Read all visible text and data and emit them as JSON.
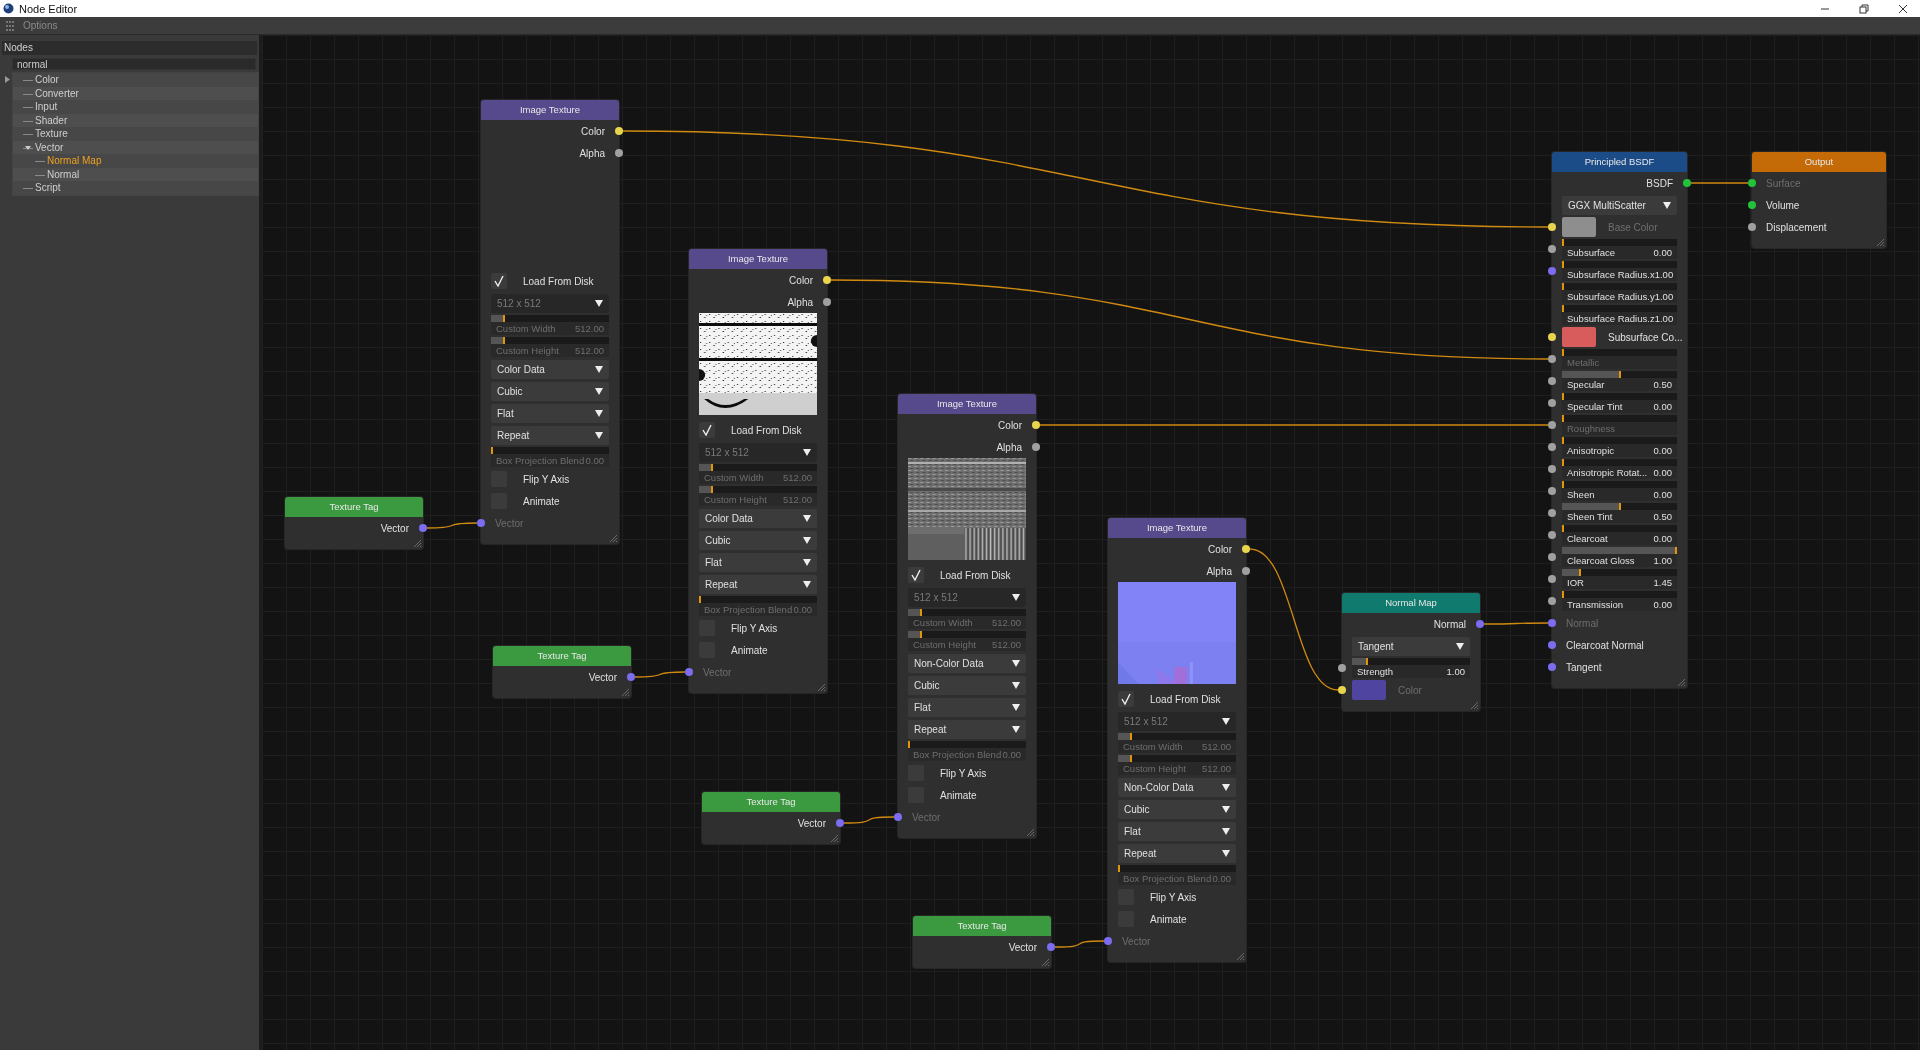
{
  "window": {
    "title": "Node Editor"
  },
  "menu": [
    "Options"
  ],
  "sidebar": {
    "title": "Nodes",
    "search": {
      "value": "normal"
    },
    "tree": [
      {
        "label": "Color",
        "selected": false
      },
      {
        "label": "Converter",
        "selected": false
      },
      {
        "label": "Input",
        "selected": false
      },
      {
        "label": "Shader",
        "selected": false
      },
      {
        "label": "Texture",
        "selected": false
      },
      {
        "label": "Vector",
        "selected": false,
        "expanded": true,
        "children": [
          {
            "label": "Normal Map",
            "selected": true
          },
          {
            "label": "Normal",
            "selected": false
          }
        ]
      },
      {
        "label": "Script",
        "selected": false
      }
    ]
  },
  "nodes": [
    {
      "title": "Image Texture",
      "color": "#574a8c",
      "rows": [
        {
          "kind": "output",
          "label": "Color",
          "socket": {
            "color": "#e8d44d"
          },
          "disabled": false
        },
        {
          "kind": "output",
          "label": "Alpha",
          "socket": {
            "color": "#a0a0a0"
          },
          "disabled": false
        },
        {
          "kind": "blank"
        },
        {
          "kind": "checkbox",
          "label": "Load From Disk",
          "checked": true
        },
        {
          "kind": "dropdown",
          "value": "512 x 512",
          "disabled": true
        },
        {
          "kind": "slider",
          "label": "Custom Width",
          "value": "512.00",
          "level": 0.1,
          "disabled": true
        },
        {
          "kind": "slider",
          "label": "Custom Height",
          "value": "512.00",
          "level": 0.1,
          "disabled": true
        },
        {
          "kind": "dropdown",
          "value": "Color Data",
          "disabled": false
        },
        {
          "kind": "dropdown",
          "value": "Cubic",
          "disabled": false
        },
        {
          "kind": "dropdown",
          "value": "Flat",
          "disabled": false
        },
        {
          "kind": "dropdown",
          "value": "Repeat",
          "disabled": false
        },
        {
          "kind": "slider",
          "label": "Box Projection Blend",
          "value": "0.00",
          "level": 0,
          "disabled": true
        },
        {
          "kind": "checkbox",
          "label": "Flip Y Axis",
          "checked": false
        },
        {
          "kind": "checkbox",
          "label": "Animate",
          "checked": false
        },
        {
          "kind": "input",
          "label": "Vector",
          "socket": {
            "color": "#7b6cf0"
          },
          "disabled": true
        }
      ]
    },
    {
      "title": "Image Texture",
      "color": "#574a8c",
      "rows": [
        {
          "kind": "output",
          "label": "Color",
          "socket": {
            "color": "#e8d44d"
          },
          "disabled": false
        },
        {
          "kind": "output",
          "label": "Alpha",
          "socket": {
            "color": "#a0a0a0"
          },
          "disabled": false
        },
        {
          "kind": "picture"
        },
        {
          "kind": "checkbox",
          "label": "Load From Disk",
          "checked": true
        },
        {
          "kind": "dropdown",
          "value": "512 x 512",
          "disabled": true
        },
        {
          "kind": "slider",
          "label": "Custom Width",
          "value": "512.00",
          "level": 0.1,
          "disabled": true
        },
        {
          "kind": "slider",
          "label": "Custom Height",
          "value": "512.00",
          "level": 0.1,
          "disabled": true
        },
        {
          "kind": "dropdown",
          "value": "Color Data",
          "disabled": false
        },
        {
          "kind": "dropdown",
          "value": "Cubic",
          "disabled": false
        },
        {
          "kind": "dropdown",
          "value": "Flat",
          "disabled": false
        },
        {
          "kind": "dropdown",
          "value": "Repeat",
          "disabled": false
        },
        {
          "kind": "slider",
          "label": "Box Projection Blend",
          "value": "0.00",
          "level": 0,
          "disabled": true
        },
        {
          "kind": "checkbox",
          "label": "Flip Y Axis",
          "checked": false
        },
        {
          "kind": "checkbox",
          "label": "Animate",
          "checked": false
        },
        {
          "kind": "input",
          "label": "Vector",
          "socket": {
            "color": "#7b6cf0"
          },
          "disabled": true
        }
      ]
    },
    {
      "title": "Image Texture",
      "color": "#574a8c",
      "rows": [
        {
          "kind": "output",
          "label": "Color",
          "socket": {
            "color": "#e8d44d"
          },
          "disabled": false
        },
        {
          "kind": "output",
          "label": "Alpha",
          "socket": {
            "color": "#a0a0a0"
          },
          "disabled": false
        },
        {
          "kind": "picture"
        },
        {
          "kind": "checkbox",
          "label": "Load From Disk",
          "checked": true
        },
        {
          "kind": "dropdown",
          "value": "512 x 512",
          "disabled": true
        },
        {
          "kind": "slider",
          "label": "Custom Width",
          "value": "512.00",
          "level": 0.1,
          "disabled": true
        },
        {
          "kind": "slider",
          "label": "Custom Height",
          "value": "512.00",
          "level": 0.1,
          "disabled": true
        },
        {
          "kind": "dropdown",
          "value": "Non-Color Data",
          "disabled": false
        },
        {
          "kind": "dropdown",
          "value": "Cubic",
          "disabled": false
        },
        {
          "kind": "dropdown",
          "value": "Flat",
          "disabled": false
        },
        {
          "kind": "dropdown",
          "value": "Repeat",
          "disabled": false
        },
        {
          "kind": "slider",
          "label": "Box Projection Blend",
          "value": "0.00",
          "level": 0,
          "disabled": true
        },
        {
          "kind": "checkbox",
          "label": "Flip Y Axis",
          "checked": false
        },
        {
          "kind": "checkbox",
          "label": "Animate",
          "checked": false
        },
        {
          "kind": "input",
          "label": "Vector",
          "socket": {
            "color": "#7b6cf0"
          },
          "disabled": true
        }
      ]
    },
    {
      "title": "Image Texture",
      "color": "#574a8c",
      "rows": [
        {
          "kind": "output",
          "label": "Color",
          "socket": {
            "color": "#e8d44d"
          },
          "disabled": false
        },
        {
          "kind": "output",
          "label": "Alpha",
          "socket": {
            "color": "#a0a0a0"
          },
          "disabled": false
        },
        {
          "kind": "picture"
        },
        {
          "kind": "checkbox",
          "label": "Load From Disk",
          "checked": true
        },
        {
          "kind": "dropdown",
          "value": "512 x 512",
          "disabled": true
        },
        {
          "kind": "slider",
          "label": "Custom Width",
          "value": "512.00",
          "level": 0.1,
          "disabled": true
        },
        {
          "kind": "slider",
          "label": "Custom Height",
          "value": "512.00",
          "level": 0.1,
          "disabled": true
        },
        {
          "kind": "dropdown",
          "value": "Non-Color Data",
          "disabled": false
        },
        {
          "kind": "dropdown",
          "value": "Cubic",
          "disabled": false
        },
        {
          "kind": "dropdown",
          "value": "Flat",
          "disabled": false
        },
        {
          "kind": "dropdown",
          "value": "Repeat",
          "disabled": false
        },
        {
          "kind": "slider",
          "label": "Box Projection Blend",
          "value": "0.00",
          "level": 0,
          "disabled": true
        },
        {
          "kind": "checkbox",
          "label": "Flip Y Axis",
          "checked": false
        },
        {
          "kind": "checkbox",
          "label": "Animate",
          "checked": false
        },
        {
          "kind": "input",
          "label": "Vector",
          "socket": {
            "color": "#7b6cf0"
          },
          "disabled": true
        }
      ]
    },
    {
      "title": "Texture Tag",
      "color": "#3b9a40",
      "rows": [
        {
          "kind": "output",
          "label": "Vector",
          "socket": {
            "color": "#7b6cf0"
          },
          "disabled": false
        }
      ]
    },
    {
      "title": "Texture Tag",
      "color": "#3b9a40",
      "rows": [
        {
          "kind": "output",
          "label": "Vector",
          "socket": {
            "color": "#7b6cf0"
          },
          "disabled": false
        }
      ]
    },
    {
      "title": "Texture Tag",
      "color": "#3b9a40",
      "rows": [
        {
          "kind": "output",
          "label": "Vector",
          "socket": {
            "color": "#7b6cf0"
          },
          "disabled": false
        }
      ]
    },
    {
      "title": "Texture Tag",
      "color": "#3b9a40",
      "rows": [
        {
          "kind": "output",
          "label": "Vector",
          "socket": {
            "color": "#7b6cf0"
          },
          "disabled": false
        }
      ]
    },
    {
      "title": "Normal Map",
      "color": "#0f7a6d",
      "rows": [
        {
          "kind": "output",
          "label": "Normal",
          "socket": {
            "color": "#7b6cf0"
          },
          "disabled": false
        },
        {
          "kind": "dropdown",
          "value": "Tangent",
          "disabled": false
        },
        {
          "kind": "slider",
          "label": "Strength",
          "value": "1.00",
          "level": 0.12,
          "disabled": false,
          "socket": {
            "color": "#a0a0a0"
          }
        },
        {
          "kind": "swatch",
          "label": "Color",
          "color": "#4f45a0",
          "disabled": true,
          "socket": {
            "color": "#e8d44d"
          }
        }
      ]
    },
    {
      "title": "Principled BSDF",
      "color": "#1c4c88",
      "rows": [
        {
          "kind": "output",
          "label": "BSDF",
          "socket": {
            "color": "#22c33a"
          },
          "disabled": false
        },
        {
          "kind": "dropdown",
          "value": "GGX MultiScatter",
          "disabled": false
        },
        {
          "kind": "swatch",
          "label": "Base Color",
          "color": "#8e8e8e",
          "disabled": true,
          "socket": {
            "color": "#e8d44d"
          }
        },
        {
          "kind": "slider",
          "label": "Subsurface",
          "value": "0.00",
          "level": 0,
          "disabled": false,
          "socket": {
            "color": "#a0a0a0"
          }
        },
        {
          "kind": "slider",
          "label": "Subsurface Radius.x",
          "value": "1.00",
          "level": 0,
          "disabled": false,
          "socket": {
            "color": "#7b6cf0"
          }
        },
        {
          "kind": "slider",
          "label": "Subsurface Radius.y",
          "value": "1.00",
          "level": 0,
          "disabled": false
        },
        {
          "kind": "slider",
          "label": "Subsurface Radius.z",
          "value": "1.00",
          "level": 0,
          "disabled": false
        },
        {
          "kind": "swatch",
          "label": "Subsurface Co...",
          "color": "#d95c5c",
          "disabled": false,
          "socket": {
            "color": "#e8d44d"
          }
        },
        {
          "kind": "slider",
          "label": "Metallic",
          "level": 0,
          "disabled": true,
          "socket": {
            "color": "#a0a0a0"
          }
        },
        {
          "kind": "slider",
          "label": "Specular",
          "value": "0.50",
          "level": 0.5,
          "disabled": false,
          "socket": {
            "color": "#a0a0a0"
          }
        },
        {
          "kind": "slider",
          "label": "Specular Tint",
          "value": "0.00",
          "level": 0,
          "disabled": false,
          "socket": {
            "color": "#a0a0a0"
          }
        },
        {
          "kind": "slider",
          "label": "Roughness",
          "level": 0,
          "disabled": true,
          "socket": {
            "color": "#a0a0a0"
          }
        },
        {
          "kind": "slider",
          "label": "Anisotropic",
          "value": "0.00",
          "level": 0,
          "disabled": false,
          "socket": {
            "color": "#a0a0a0"
          }
        },
        {
          "kind": "slider",
          "label": "Anisotropic Rotat...",
          "value": "0.00",
          "level": 0,
          "disabled": false,
          "socket": {
            "color": "#a0a0a0"
          }
        },
        {
          "kind": "slider",
          "label": "Sheen",
          "value": "0.00",
          "level": 0,
          "disabled": false,
          "socket": {
            "color": "#a0a0a0"
          }
        },
        {
          "kind": "slider",
          "label": "Sheen Tint",
          "value": "0.50",
          "level": 0.5,
          "disabled": false,
          "socket": {
            "color": "#a0a0a0"
          }
        },
        {
          "kind": "slider",
          "label": "Clearcoat",
          "value": "0.00",
          "level": 0,
          "disabled": false,
          "socket": {
            "color": "#a0a0a0"
          }
        },
        {
          "kind": "slider",
          "label": "Clearcoat Gloss",
          "value": "1.00",
          "level": 1,
          "disabled": false,
          "socket": {
            "color": "#a0a0a0"
          }
        },
        {
          "kind": "slider",
          "label": "IOR",
          "value": "1.45",
          "level": 0.15,
          "disabled": false,
          "socket": {
            "color": "#a0a0a0"
          }
        },
        {
          "kind": "slider",
          "label": "Transmission",
          "value": "0.00",
          "level": 0,
          "disabled": false,
          "socket": {
            "color": "#a0a0a0"
          }
        },
        {
          "kind": "input",
          "label": "Normal",
          "socket": {
            "color": "#7b6cf0"
          },
          "disabled": true
        },
        {
          "kind": "input",
          "label": "Clearcoat Normal",
          "socket": {
            "color": "#7b6cf0"
          },
          "disabled": false
        },
        {
          "kind": "input",
          "label": "Tangent",
          "socket": {
            "color": "#7b6cf0"
          },
          "disabled": false
        }
      ]
    },
    {
      "title": "Output",
      "color": "#c46a06",
      "rows": [
        {
          "kind": "input",
          "label": "Surface",
          "socket": {
            "color": "#22c33a"
          },
          "disabled": true
        },
        {
          "kind": "input",
          "label": "Volume",
          "socket": {
            "color": "#22c33a"
          },
          "disabled": false
        },
        {
          "kind": "input",
          "label": "Displacement",
          "socket": {
            "color": "#a0a0a0"
          },
          "disabled": false
        }
      ]
    }
  ]
}
